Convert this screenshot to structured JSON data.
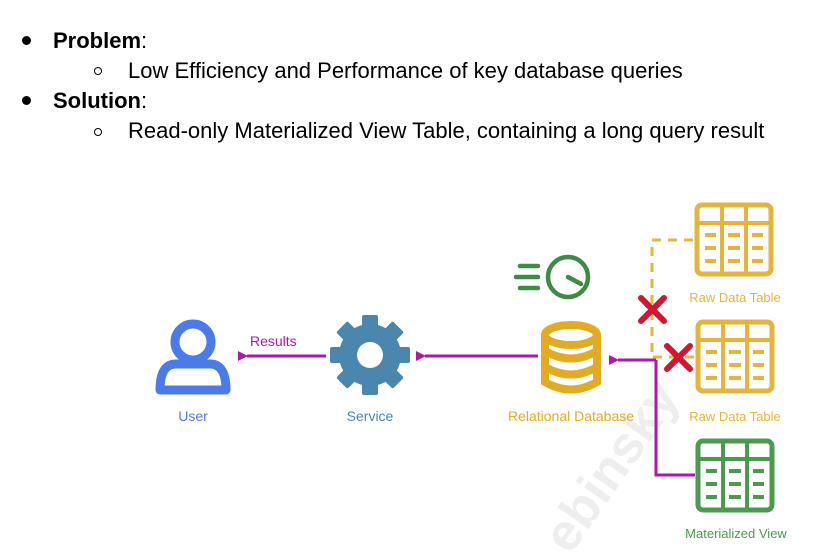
{
  "bullets": {
    "problem": {
      "label": "Problem",
      "suffix": ":",
      "detail": "Low Efficiency and Performance of key database queries"
    },
    "solution": {
      "label": "Solution",
      "suffix": ":",
      "detail": "Read-only Materialized View Table, containing a long query result"
    }
  },
  "diagram": {
    "user_label": "User",
    "service_label": "Service",
    "database_label": "Relational Database",
    "raw_table_1_label": "Raw Data Table",
    "raw_table_2_label": "Raw Data Table",
    "materialized_view_label": "Materialized View",
    "results_label": "Results",
    "watermark": "ebinsky",
    "colors": {
      "user": "#4a7be8",
      "service": "#4a86ad",
      "database": "#e2ac22",
      "raw_table": "#e6b43a",
      "materialized_view": "#4c9a4f",
      "arrow": "#b115ae",
      "blocked": "#d6142f",
      "dashed": "#e2b73a",
      "clock": "#3f8a45"
    }
  }
}
